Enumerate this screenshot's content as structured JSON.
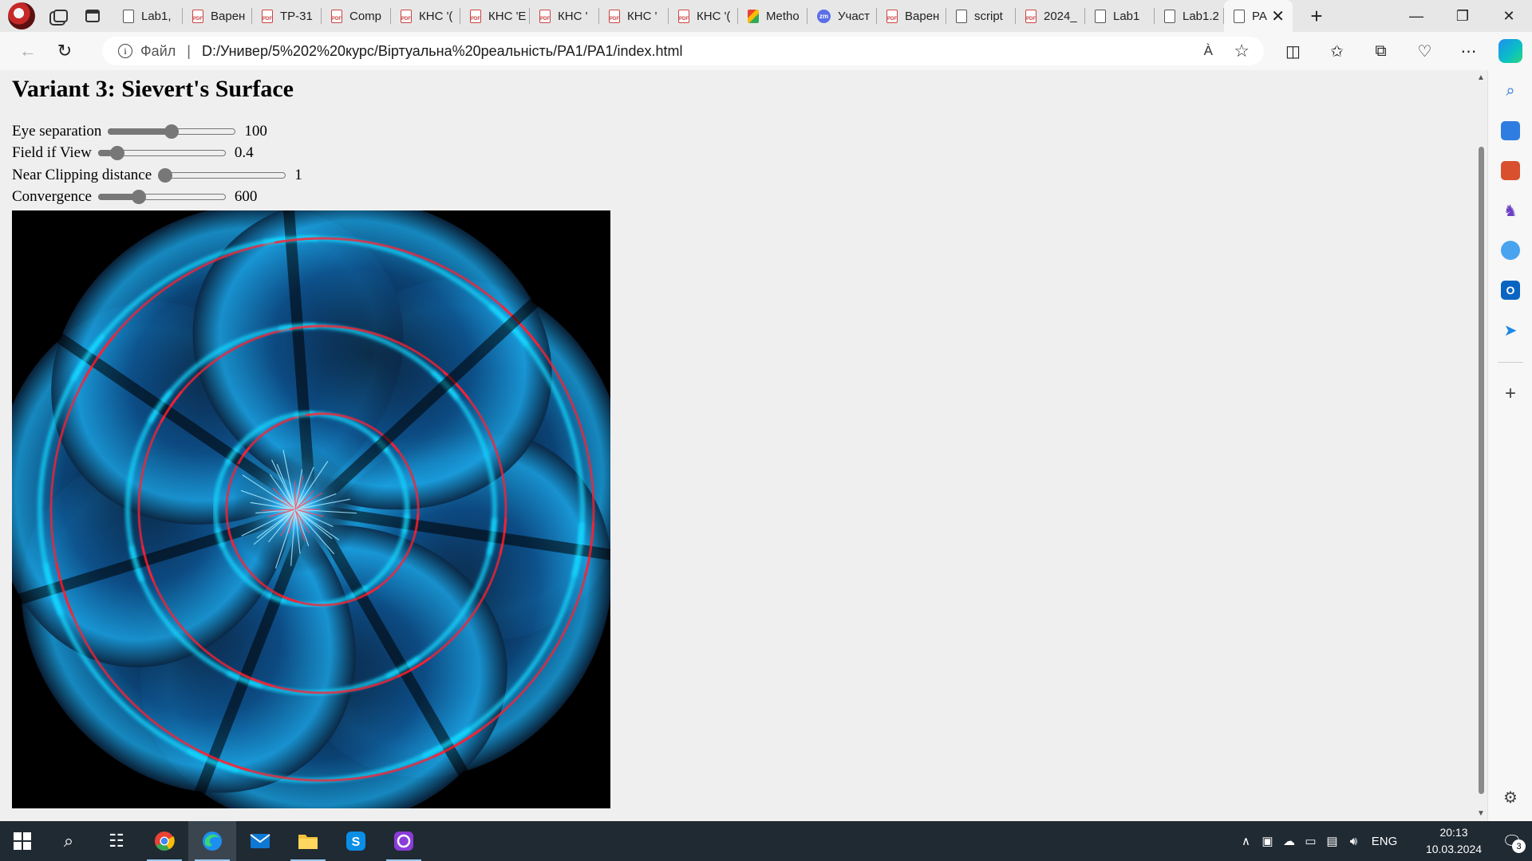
{
  "browser": {
    "tabs": [
      {
        "title": "Lab1,",
        "icon": "doc"
      },
      {
        "title": "Варен",
        "icon": "pdf"
      },
      {
        "title": "ТР-31",
        "icon": "pdf"
      },
      {
        "title": "Comp",
        "icon": "pdf"
      },
      {
        "title": "КНС '(",
        "icon": "pdf"
      },
      {
        "title": "КНС 'E",
        "icon": "pdf"
      },
      {
        "title": "КНС '",
        "icon": "pdf"
      },
      {
        "title": "КНС '",
        "icon": "pdf"
      },
      {
        "title": "КНС '(",
        "icon": "pdf"
      },
      {
        "title": "Metho",
        "icon": "gmail"
      },
      {
        "title": "Участ",
        "icon": "zoom"
      },
      {
        "title": "Варен",
        "icon": "pdf"
      },
      {
        "title": "script",
        "icon": "doc"
      },
      {
        "title": "2024_",
        "icon": "pdf"
      },
      {
        "title": "Lab1",
        "icon": "doc"
      },
      {
        "title": "Lab1.2",
        "icon": "doc"
      },
      {
        "title": "PA",
        "icon": "doc",
        "active": true
      }
    ],
    "new_tab_label": "+",
    "address": {
      "scheme_label": "Файл",
      "separator": "|",
      "url": "D:/Универ/5%202%20курс/Віртуальна%20реальність/PA1/PA1/index.html"
    }
  },
  "page": {
    "title": "Variant 3: Sievert's Surface",
    "controls": [
      {
        "label": "Eye separation",
        "value": "100",
        "min": 0,
        "max": 200,
        "current": 100
      },
      {
        "label": "Field if View",
        "value": "0.4",
        "min": 0.1,
        "max": 3.0,
        "current": 0.4
      },
      {
        "label": "Near Clipping distance",
        "value": "1",
        "min": 1,
        "max": 100,
        "current": 1
      },
      {
        "label": "Convergence",
        "value": "600",
        "min": 0,
        "max": 2000,
        "current": 600
      }
    ]
  },
  "taskbar": {
    "apps": [
      "windows-start",
      "search",
      "task-view",
      "chrome",
      "edge",
      "mail",
      "file-explorer",
      "skype",
      "github-desktop"
    ],
    "tray": {
      "language": "ENG",
      "time": "20:13",
      "date": "10.03.2024",
      "notifications": "3"
    }
  },
  "colors": {
    "accent_cyan": "#18d8ff",
    "accent_red": "#ff2030",
    "taskbar": "#202a33"
  }
}
